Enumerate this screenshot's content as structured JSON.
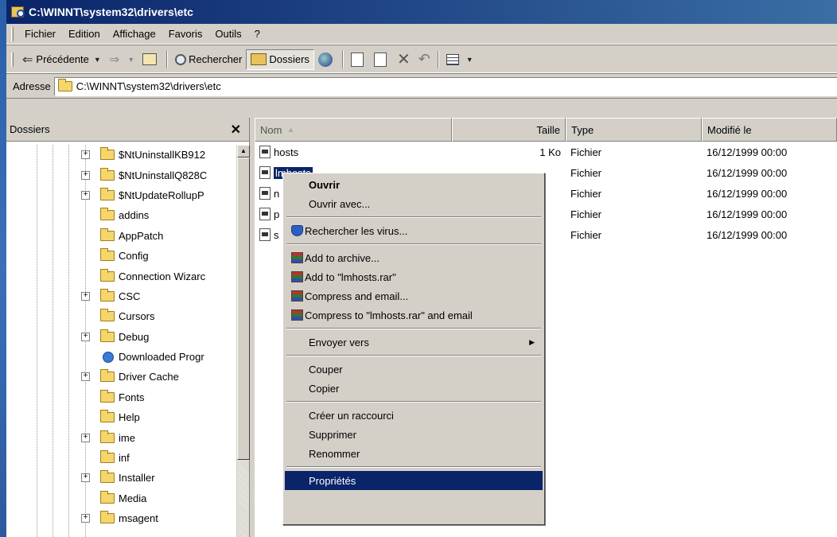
{
  "window": {
    "title": "C:\\WINNT\\system32\\drivers\\etc"
  },
  "menu": [
    "Fichier",
    "Edition",
    "Affichage",
    "Favoris",
    "Outils",
    "?"
  ],
  "toolbar": {
    "back_label": "Précédente",
    "search_label": "Rechercher",
    "folders_label": "Dossiers"
  },
  "address": {
    "label": "Adresse",
    "value": "C:\\WINNT\\system32\\drivers\\etc"
  },
  "tree": {
    "header": "Dossiers",
    "items": [
      {
        "label": "$NtUninstallKB912",
        "expandable": true
      },
      {
        "label": "$NtUninstallQ828C",
        "expandable": true
      },
      {
        "label": "$NtUpdateRollupP",
        "expandable": true
      },
      {
        "label": "addins",
        "expandable": false
      },
      {
        "label": "AppPatch",
        "expandable": false
      },
      {
        "label": "Config",
        "expandable": false
      },
      {
        "label": "Connection Wizarc",
        "expandable": false
      },
      {
        "label": "CSC",
        "expandable": true
      },
      {
        "label": "Cursors",
        "expandable": false
      },
      {
        "label": "Debug",
        "expandable": true
      },
      {
        "label": "Downloaded Progr",
        "expandable": false,
        "icon": "ie"
      },
      {
        "label": "Driver Cache",
        "expandable": true
      },
      {
        "label": "Fonts",
        "expandable": false
      },
      {
        "label": "Help",
        "expandable": false
      },
      {
        "label": "ime",
        "expandable": true
      },
      {
        "label": "inf",
        "expandable": false
      },
      {
        "label": "Installer",
        "expandable": true
      },
      {
        "label": "Media",
        "expandable": false
      },
      {
        "label": "msagent",
        "expandable": true
      }
    ]
  },
  "list": {
    "columns": {
      "name": "Nom",
      "size": "Taille",
      "type": "Type",
      "modified": "Modifié le"
    },
    "rows": [
      {
        "name": "hosts",
        "size": "1 Ko",
        "type": "Fichier",
        "modified": "16/12/1999 00:00"
      },
      {
        "name": "lmhosts",
        "size": "",
        "type": "Fichier",
        "modified": "16/12/1999 00:00",
        "selected": true
      },
      {
        "name": "n",
        "size": "",
        "type": "Fichier",
        "modified": "16/12/1999 00:00"
      },
      {
        "name": "p",
        "size": "",
        "type": "Fichier",
        "modified": "16/12/1999 00:00"
      },
      {
        "name": "s",
        "size": "",
        "type": "Fichier",
        "modified": "16/12/1999 00:00"
      }
    ]
  },
  "context_menu": {
    "open": "Ouvrir",
    "open_with": "Ouvrir avec...",
    "virus_scan": "Rechercher les virus...",
    "add_archive": "Add to archive...",
    "add_rar": "Add to \"lmhosts.rar\"",
    "compress_email": "Compress and email...",
    "compress_rar_email": "Compress to \"lmhosts.rar\" and email",
    "send_to": "Envoyer vers",
    "cut": "Couper",
    "copy": "Copier",
    "create_shortcut": "Créer un raccourci",
    "delete": "Supprimer",
    "rename": "Renommer",
    "properties": "Propriétés"
  }
}
